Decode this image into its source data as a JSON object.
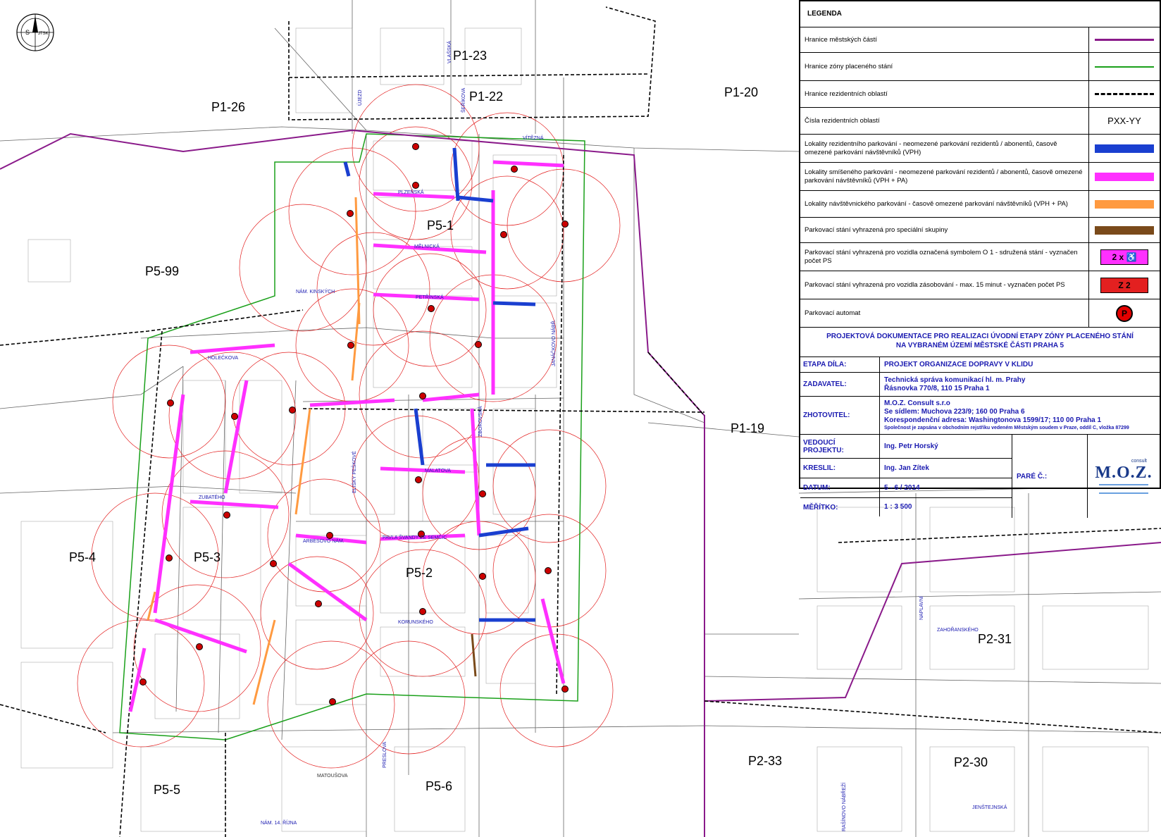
{
  "map": {
    "zones": [
      {
        "id": "P1-23"
      },
      {
        "id": "P1-22"
      },
      {
        "id": "P1-26"
      },
      {
        "id": "P1-20"
      },
      {
        "id": "P5-1"
      },
      {
        "id": "P5-99"
      },
      {
        "id": "P1-19"
      },
      {
        "id": "P5-4"
      },
      {
        "id": "P5-3"
      },
      {
        "id": "P5-2"
      },
      {
        "id": "P2-31"
      },
      {
        "id": "P2-33"
      },
      {
        "id": "P2-30"
      },
      {
        "id": "P5-5"
      },
      {
        "id": "P5-6"
      }
    ],
    "streets": [
      "PLZEŇSKÁ",
      "MĚLNICKÁ",
      "PETŘÍNSKÁ",
      "NÁM. KINSKÝCH",
      "HOLEČKOVA",
      "ZUBATÉHO",
      "MALATOVA",
      "PAVLA ŠVANDY ZE SEMČIC",
      "ARBESOVO NÁM.",
      "KORUNSKÉHO",
      "ZBOROVSKÁ",
      "JANÁČKOVO NÁBŘ.",
      "VÍTĚZNÁ",
      "MATOUŠOVA",
      "ELIŠKY PEŠKOVÉ",
      "PRESLOVA",
      "NAPLAVNÍ",
      "ZAHOŘANSKÉHO",
      "JENŠTEJNSKÁ",
      "RAŠÍNOVO NÁBŘEŽÍ",
      "NÁM. 14. ŘÍJNA",
      "ŠEŘÍKOVA",
      "VLAŠSKÁ",
      "ÚJEZD"
    ],
    "colors": {
      "district_border": "#8a1a8a",
      "paid_zone_border": "#1aa01a",
      "resident_border": "#000000",
      "resident_parking": "#1a3fd0",
      "mixed_parking": "#ff30ff",
      "visitor_parking": "#ff9a40",
      "special_parking": "#7a4a1a",
      "meter_circle": "#e32020",
      "map_lines": "#555555"
    }
  },
  "compass": {
    "s": "S",
    "label": "JTSK"
  },
  "legend": {
    "title": "LEGENDA",
    "items": [
      {
        "text": "Hranice městských částí",
        "symbol": "district-line-icon"
      },
      {
        "text": "Hranice zóny placeného stání",
        "symbol": "zone-line-icon"
      },
      {
        "text": "Hranice rezidentních oblastí",
        "symbol": "dashed-line-icon"
      },
      {
        "text": "Čísla rezidentních oblastí",
        "symbol_text": "PXX-YY"
      },
      {
        "text": "Lokality rezidentního parkování - neomezené parkování rezidentů / abonentů, časově omezené parkování návštěvníků (VPH)",
        "symbol": "blue-bar-icon"
      },
      {
        "text": "Lokality smíšeného parkování - neomezené parkování rezidentů / abonentů, časově omezené parkování návštěvníků (VPH + PA)",
        "symbol": "magenta-bar-icon"
      },
      {
        "text": "Lokality návštěvnického parkování - časově omezené parkování návštěvníků (VPH + PA)",
        "symbol": "orange-bar-icon"
      },
      {
        "text": "Parkovací stání vyhrazená pro speciální skupiny",
        "symbol": "brown-bar-icon"
      },
      {
        "text": "Parkovací stání vyhrazená pro vozidla označená symbolem O 1 - sdružená stání - vyznačen počet PS",
        "symbol_text": "2 x ♿"
      },
      {
        "text": "Parkovací stání vyhrazená pro vozidla zásobování - max. 15 minut - vyznačen počet PS",
        "symbol_text": "Z 2"
      },
      {
        "text": "Parkovací automat",
        "symbol_text": "P"
      }
    ],
    "project_title_1": "PROJEKTOVÁ DOKUMENTACE PRO REALIZACI ÚVODNÍ ETAPY ZÓNY PLACENÉHO STÁNÍ",
    "project_title_2": "NA VYBRANÉM ÚZEMÍ MĚSTSKÉ ČÁSTI PRAHA 5",
    "etapa_label": "ETAPA DÍLA:",
    "etapa_value": "PROJEKT ORGANIZACE DOPRAVY V KLIDU",
    "zadavatel_label": "ZADAVATEL:",
    "zadavatel_1": "Technická správa komunikací hl. m. Prahy",
    "zadavatel_2": "Řásnovka 770/8, 110 15 Praha 1",
    "zhotovitel_label": "ZHOTOVITEL:",
    "zhotovitel_1": "M.O.Z. Consult s.r.o",
    "zhotovitel_2": "Se sídlem: Muchova 223/9; 160 00 Praha 6",
    "zhotovitel_3": "Korespondenční adresa: Washingtonova 1599/17; 110 00 Praha 1",
    "zhotovitel_4": "Společnost je zapsána v obchodním rejstříku vedeném Městským soudem v Praze, oddíl C, vložka 87299",
    "vedouci_label": "VEDOUCÍ PROJEKTU:",
    "vedouci_value": "Ing. Petr Horský",
    "kreslil_label": "KRESLIL:",
    "kreslil_value": "Ing. Jan Zítek",
    "datum_label": "DATUM:",
    "datum_value": "5 - 6 / 2014",
    "meritko_label": "MĚŘÍTKO:",
    "meritko_value": "1 : 3 500",
    "pare_label": "PARÉ Č.:",
    "logo_text": "M.O.Z.",
    "logo_sub": "consult"
  }
}
